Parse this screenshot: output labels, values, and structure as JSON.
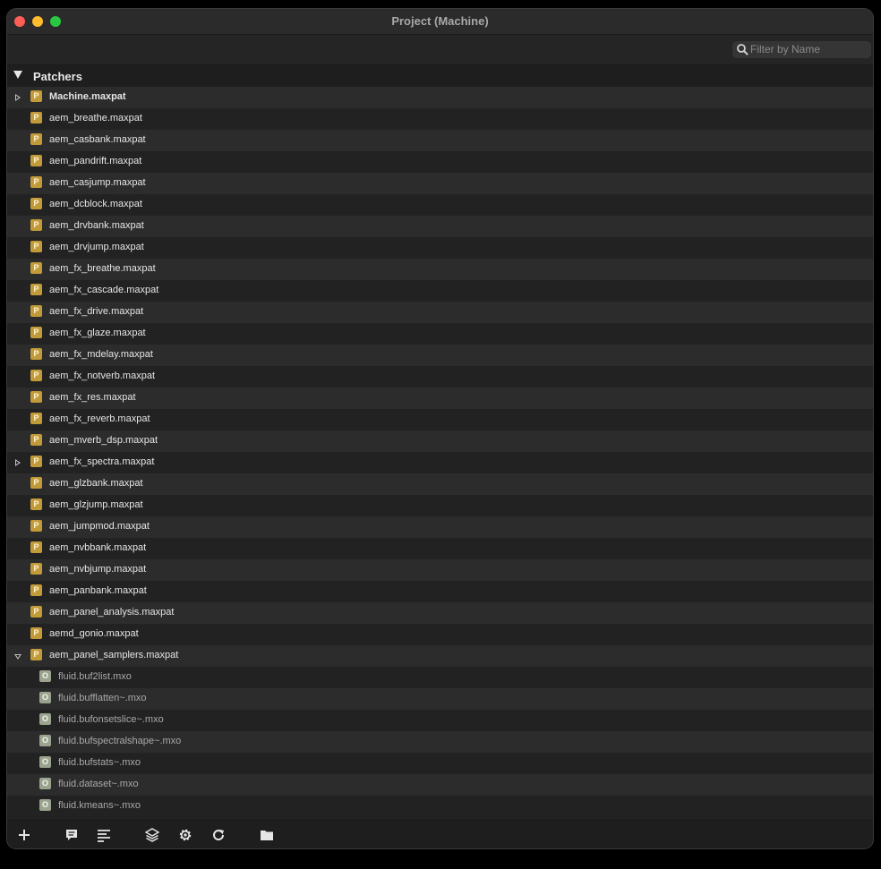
{
  "window": {
    "title": "Project (Machine)"
  },
  "search": {
    "placeholder": "Filter by Name"
  },
  "section": {
    "label": "Patchers"
  },
  "rows": [
    {
      "name": "Machine.maxpat",
      "icon": "P",
      "kind": "patcher",
      "disclosure": "closed",
      "bold": true
    },
    {
      "name": "aem_breathe.maxpat",
      "icon": "P",
      "kind": "patcher"
    },
    {
      "name": "aem_casbank.maxpat",
      "icon": "P",
      "kind": "patcher"
    },
    {
      "name": "aem_pandrift.maxpat",
      "icon": "P",
      "kind": "patcher"
    },
    {
      "name": "aem_casjump.maxpat",
      "icon": "P",
      "kind": "patcher"
    },
    {
      "name": "aem_dcblock.maxpat",
      "icon": "P",
      "kind": "patcher"
    },
    {
      "name": "aem_drvbank.maxpat",
      "icon": "P",
      "kind": "patcher"
    },
    {
      "name": "aem_drvjump.maxpat",
      "icon": "P",
      "kind": "patcher"
    },
    {
      "name": "aem_fx_breathe.maxpat",
      "icon": "P",
      "kind": "patcher"
    },
    {
      "name": "aem_fx_cascade.maxpat",
      "icon": "P",
      "kind": "patcher"
    },
    {
      "name": "aem_fx_drive.maxpat",
      "icon": "P",
      "kind": "patcher"
    },
    {
      "name": "aem_fx_glaze.maxpat",
      "icon": "P",
      "kind": "patcher"
    },
    {
      "name": "aem_fx_mdelay.maxpat",
      "icon": "P",
      "kind": "patcher"
    },
    {
      "name": "aem_fx_notverb.maxpat",
      "icon": "P",
      "kind": "patcher"
    },
    {
      "name": "aem_fx_res.maxpat",
      "icon": "P",
      "kind": "patcher"
    },
    {
      "name": "aem_fx_reverb.maxpat",
      "icon": "P",
      "kind": "patcher"
    },
    {
      "name": "aem_mverb_dsp.maxpat",
      "icon": "P",
      "kind": "patcher"
    },
    {
      "name": "aem_fx_spectra.maxpat",
      "icon": "P",
      "kind": "patcher",
      "disclosure": "closed"
    },
    {
      "name": "aem_glzbank.maxpat",
      "icon": "P",
      "kind": "patcher"
    },
    {
      "name": "aem_glzjump.maxpat",
      "icon": "P",
      "kind": "patcher"
    },
    {
      "name": "aem_jumpmod.maxpat",
      "icon": "P",
      "kind": "patcher"
    },
    {
      "name": "aem_nvbbank.maxpat",
      "icon": "P",
      "kind": "patcher"
    },
    {
      "name": "aem_nvbjump.maxpat",
      "icon": "P",
      "kind": "patcher"
    },
    {
      "name": "aem_panbank.maxpat",
      "icon": "P",
      "kind": "patcher"
    },
    {
      "name": "aem_panel_analysis.maxpat",
      "icon": "P",
      "kind": "patcher"
    },
    {
      "name": "aemd_gonio.maxpat",
      "icon": "P",
      "kind": "patcher"
    },
    {
      "name": "aem_panel_samplers.maxpat",
      "icon": "P",
      "kind": "patcher",
      "disclosure": "open"
    },
    {
      "name": "fluid.buf2list.mxo",
      "icon": "O",
      "kind": "object"
    },
    {
      "name": "fluid.bufflatten~.mxo",
      "icon": "O",
      "kind": "object"
    },
    {
      "name": "fluid.bufonsetslice~.mxo",
      "icon": "O",
      "kind": "object"
    },
    {
      "name": "fluid.bufspectralshape~.mxo",
      "icon": "O",
      "kind": "object"
    },
    {
      "name": "fluid.bufstats~.mxo",
      "icon": "O",
      "kind": "object"
    },
    {
      "name": "fluid.dataset~.mxo",
      "icon": "O",
      "kind": "object"
    },
    {
      "name": "fluid.kmeans~.mxo",
      "icon": "O",
      "kind": "object"
    }
  ],
  "toolbar": {
    "buttons": [
      "add-icon",
      "comment-icon",
      "list-icon",
      "layers-icon",
      "gear-icon",
      "refresh-icon",
      "folder-icon"
    ]
  },
  "colors": {
    "patcher_icon": "#c19a3a",
    "object_icon": "#9aa38e",
    "row_alt": "#2c2c2c",
    "row_base": "#222222"
  }
}
